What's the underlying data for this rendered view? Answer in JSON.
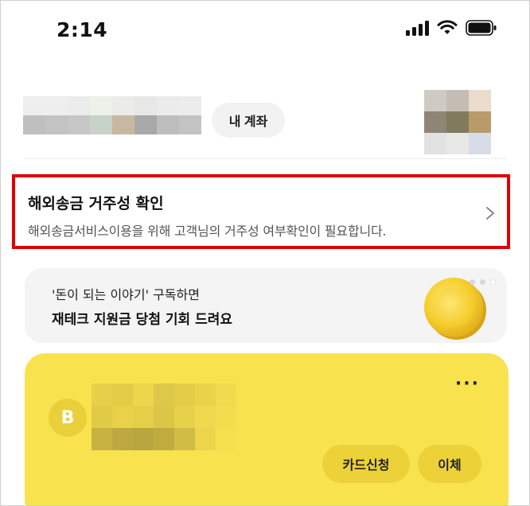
{
  "status_bar": {
    "time": "2:14",
    "icons": [
      "signal-icon",
      "wifi-icon",
      "battery-icon"
    ]
  },
  "account": {
    "my_account_label": "내 계좌"
  },
  "notice": {
    "title": "해외송금 거주성 확인",
    "subtitle": "해외송금서비스이용을 위해 고객님의 거주성 여부확인이 필요합니다.",
    "highlight_color": "#e00000"
  },
  "banner": {
    "line1": "'돈이 되는 이야기' 구독하면",
    "line2": "재테크 지원금 당첨 기회 드려요"
  },
  "card": {
    "background_color": "#f8e34f",
    "logo_letter": "B",
    "more_label": "···",
    "apply_card_label": "카드신청",
    "transfer_label": "이체"
  }
}
